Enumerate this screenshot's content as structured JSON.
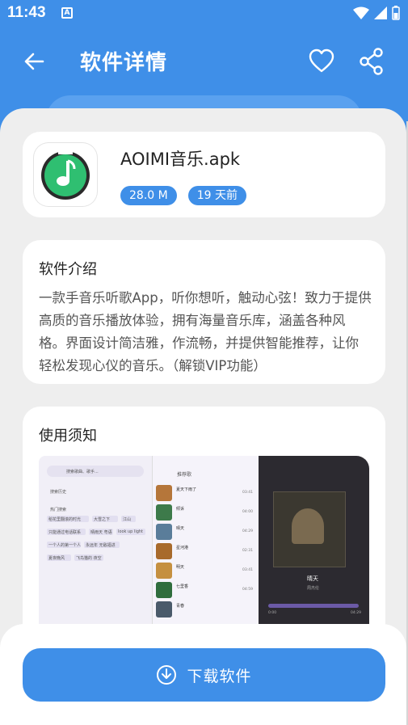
{
  "status": {
    "time": "11:43",
    "notification_icon": "A"
  },
  "appbar": {
    "title": "软件详情"
  },
  "app": {
    "name": "AOIMI音乐.apk",
    "size": "28.0 M",
    "updated": "19 天前"
  },
  "intro": {
    "title": "软件介绍",
    "text": "一款手音乐听歌App，听你想听，触动心弦！致力于提供高质的音乐播放体验，拥有海量音乐库，涵盖各种风格。界面设计简洁雅，作流畅，并提供智能推荐，让你轻松发现心仪的音乐。（解锁VIP功能）"
  },
  "notice": {
    "title": "使用须知",
    "shot1": {
      "search_placeholder": "搜索歌曲、歌手...",
      "history_label": "搜索历史",
      "hot_label": "热门搜索",
      "chips": [
        "稻花里翻滚的时光",
        "大雪之下",
        "江山",
        "只能通过电话联系",
        "晴雨天 粤语",
        "look up light",
        "一个人的第一个人",
        "永远年 无敌福进",
        "夏夜晚风",
        "飞鸟猫的 夜空"
      ]
    },
    "shot2": {
      "title": "推荐歌",
      "songs": [
        {
          "name": "夏天下雨了",
          "time": "03:41"
        },
        {
          "name": "倾诉",
          "time": "04:00"
        },
        {
          "name": "晴天",
          "time": "04:29"
        },
        {
          "name": "星河港",
          "time": "02:31"
        },
        {
          "name": "明天",
          "time": "03:41"
        },
        {
          "name": "七里香",
          "time": "04:59"
        },
        {
          "name": "青春",
          "time": ""
        }
      ]
    },
    "shot3": {
      "song_title": "晴天",
      "artist": "周杰伦",
      "time_start": "0:00",
      "time_end": "04:29"
    }
  },
  "download": {
    "label": "下载软件"
  },
  "colors": {
    "primary": "#3f8fe8",
    "background": "#eeeeee",
    "card": "#ffffff"
  }
}
